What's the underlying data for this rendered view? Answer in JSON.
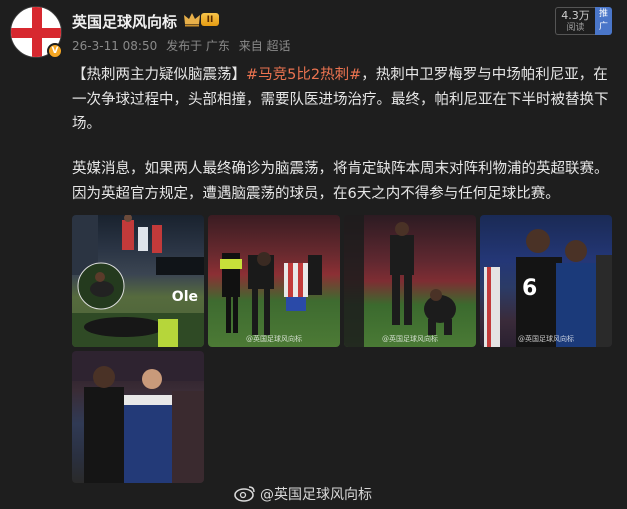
{
  "post": {
    "author": "英国足球风向标",
    "level_badge": "II",
    "verified_badge": "V",
    "date": "26-3-11 08:50",
    "published_in": "发布于 广东",
    "source": "来自 超话",
    "reads_count": "4.3万",
    "reads_label": "阅读",
    "promote_label": "推广",
    "p1_prefix": "【热刺两主力疑似脑震荡】",
    "p1_hashtag": "#马竞5比2热刺#",
    "p1_body": "，热刺中卫罗梅罗与中场帕利尼亚，在一次争球过程中，头部相撞，需要队医进场治疗。最终，帕利尼亚在下半时被替换下场。",
    "p2_body": "英媒消息，如果两人最终确诊为脑震荡，将肯定缺阵本周末对阵利物浦的英超联赛。因为英超官方规定，遭遇脑震荡的球员，在6天之内不得参与任何足球比赛。",
    "images": {
      "img1_logo_text": "Ole",
      "img2_watermark": "@英国足球风向标",
      "img3_watermark": "@英国足球风向标",
      "img4_watermark": "@英国足球风向标"
    },
    "footer_watermark": "@英国足球风向标"
  },
  "colors": {
    "background": "#1e1e1e",
    "hashtag": "#eb7350",
    "promote": "#4a76c9",
    "verified": "#f5a623",
    "flag_red": "#d7282f"
  },
  "icons": {
    "avatar": "england-flag",
    "verified": "verified-badge-icon",
    "crown": "crown-icon",
    "footer": "weibo-icon"
  }
}
